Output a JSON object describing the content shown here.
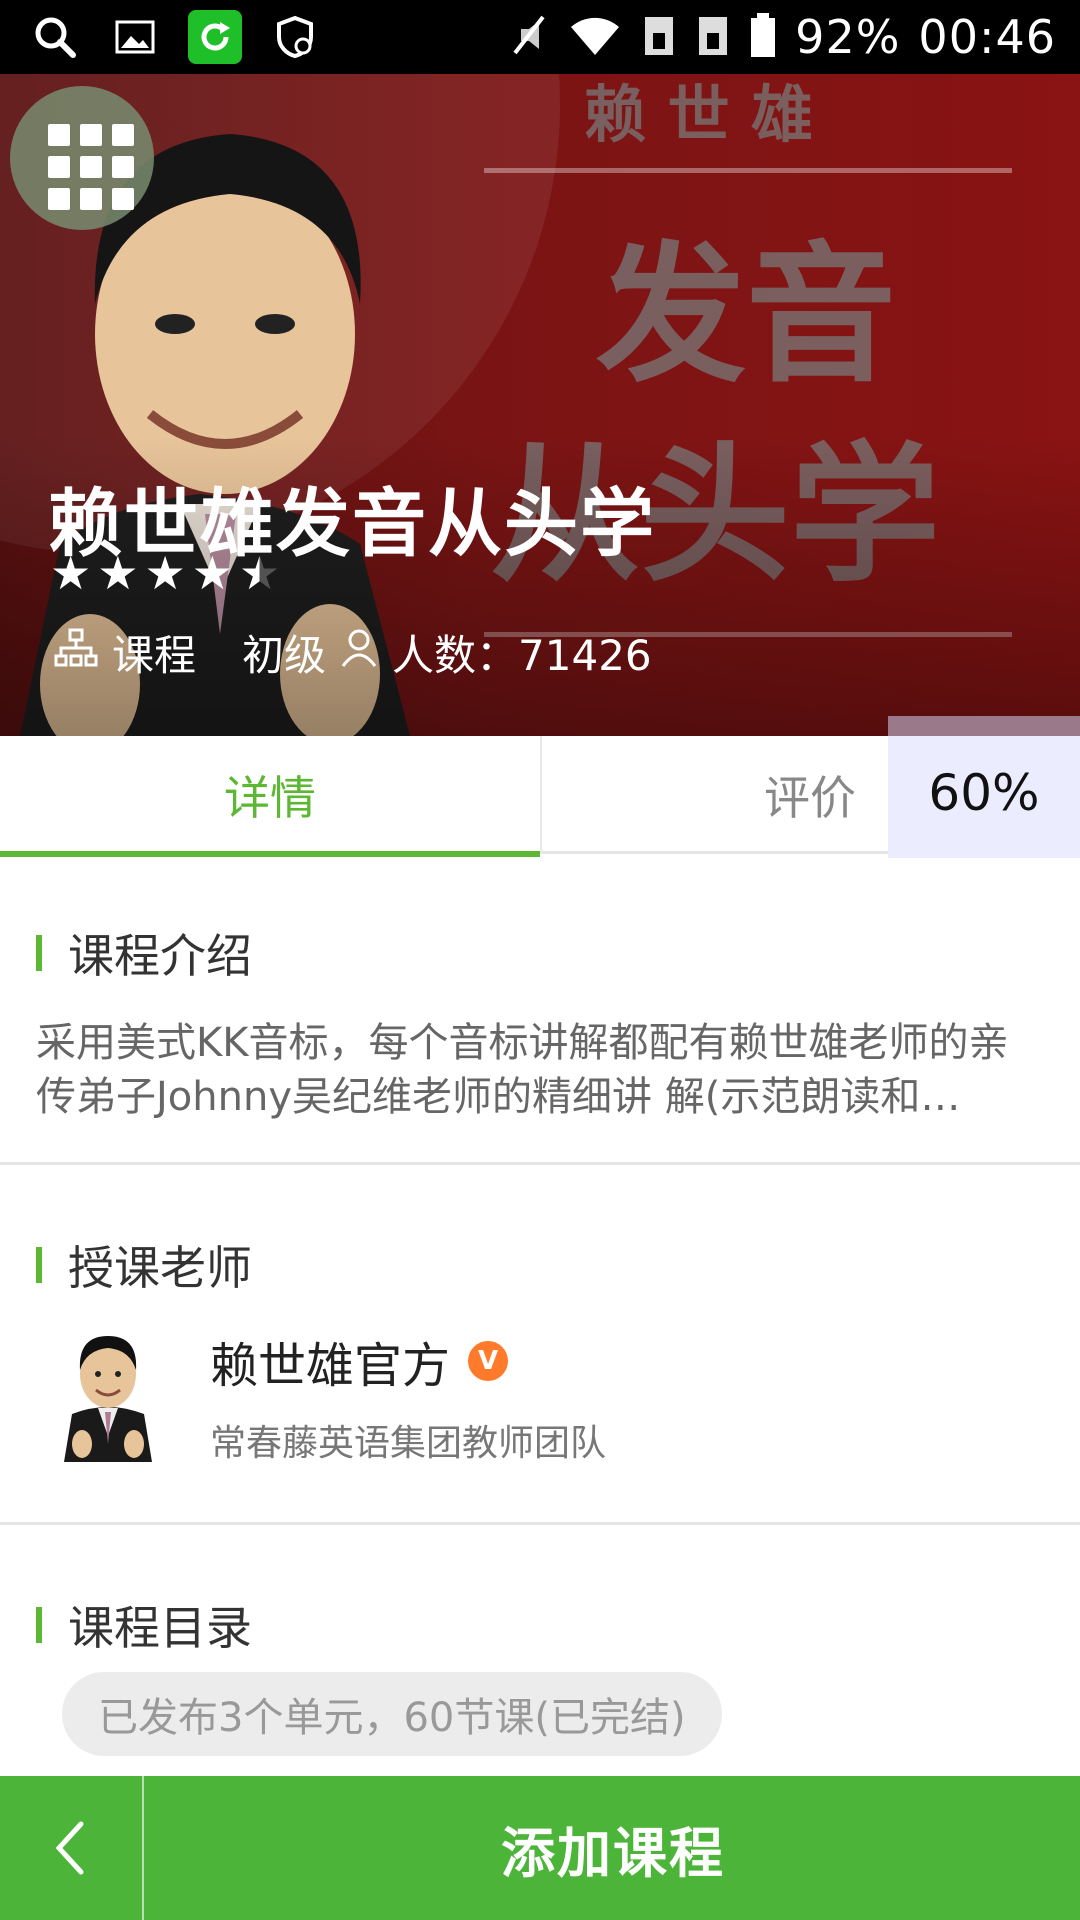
{
  "status_bar": {
    "battery": "92%",
    "time": "00:46",
    "icons": [
      "search-icon",
      "image-icon",
      "refresh-icon",
      "shield-icon",
      "mute-icon",
      "wifi-icon",
      "sim1-icon",
      "sim2-icon",
      "battery-icon"
    ]
  },
  "hero": {
    "poster_text_top": "赖 世 雄",
    "poster_text_line1": "发音",
    "poster_text_line2": "从头学",
    "title": "赖世雄发音从头学",
    "rating": 4.5,
    "type_label": "课程",
    "level": "初级",
    "count_label": "人数：71426"
  },
  "tabs": [
    {
      "label": "详情",
      "active": true
    },
    {
      "label": "评价",
      "active": false
    }
  ],
  "overlay_percent": "60%",
  "intro": {
    "heading": "课程介绍",
    "text": "采用美式KK音标，每个音标讲解都配有赖世雄老师的亲传弟子Johnny吴纪维老师的精细讲 解(示范朗读和…"
  },
  "teacher": {
    "heading": "授课老师",
    "name": "赖世雄官方",
    "badge": "V",
    "subtitle": "常春藤英语集团教师团队"
  },
  "catalog": {
    "heading": "课程目录",
    "summary": "已发布3个单元，60节课(已完结)"
  },
  "bottom": {
    "add_label": "添加课程"
  },
  "colors": {
    "accent": "#5cb832",
    "bottom_bar": "#4cb539",
    "hero_bg": "#7a1414",
    "badge": "#ff7a2a"
  }
}
